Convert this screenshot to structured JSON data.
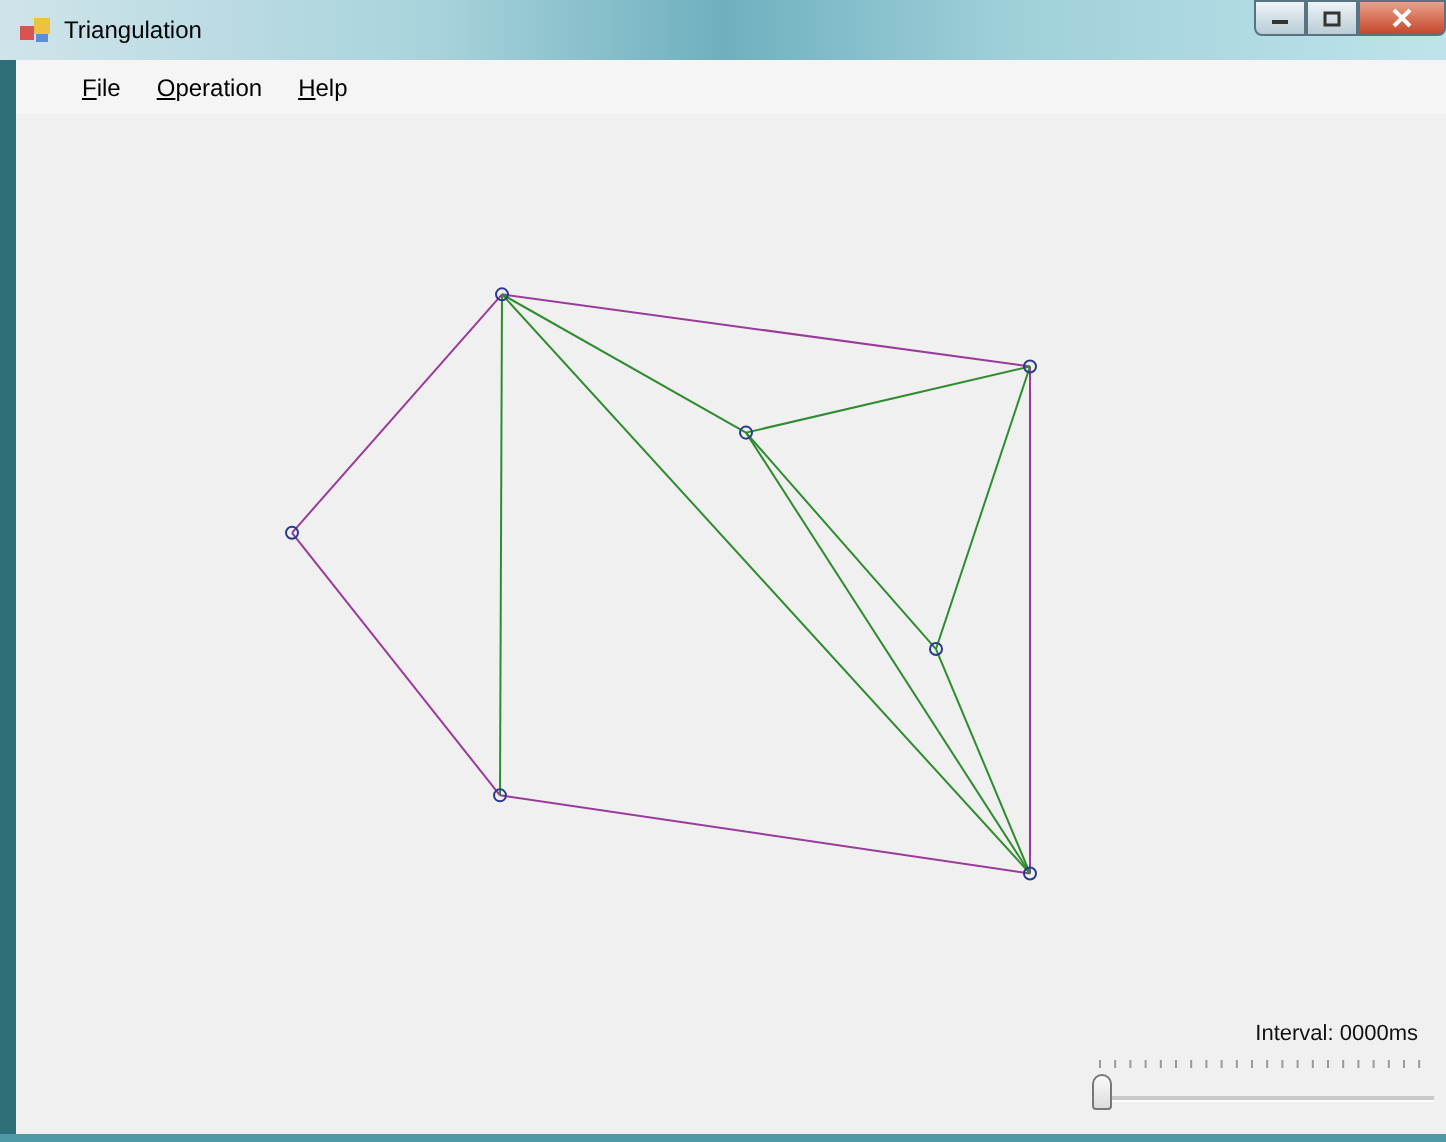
{
  "window": {
    "title": "Triangulation"
  },
  "menu": [
    {
      "label": "File"
    },
    {
      "label": "Operation"
    },
    {
      "label": "Help"
    }
  ],
  "interval": {
    "label": "Interval: 0000ms",
    "level": 0
  }
}
